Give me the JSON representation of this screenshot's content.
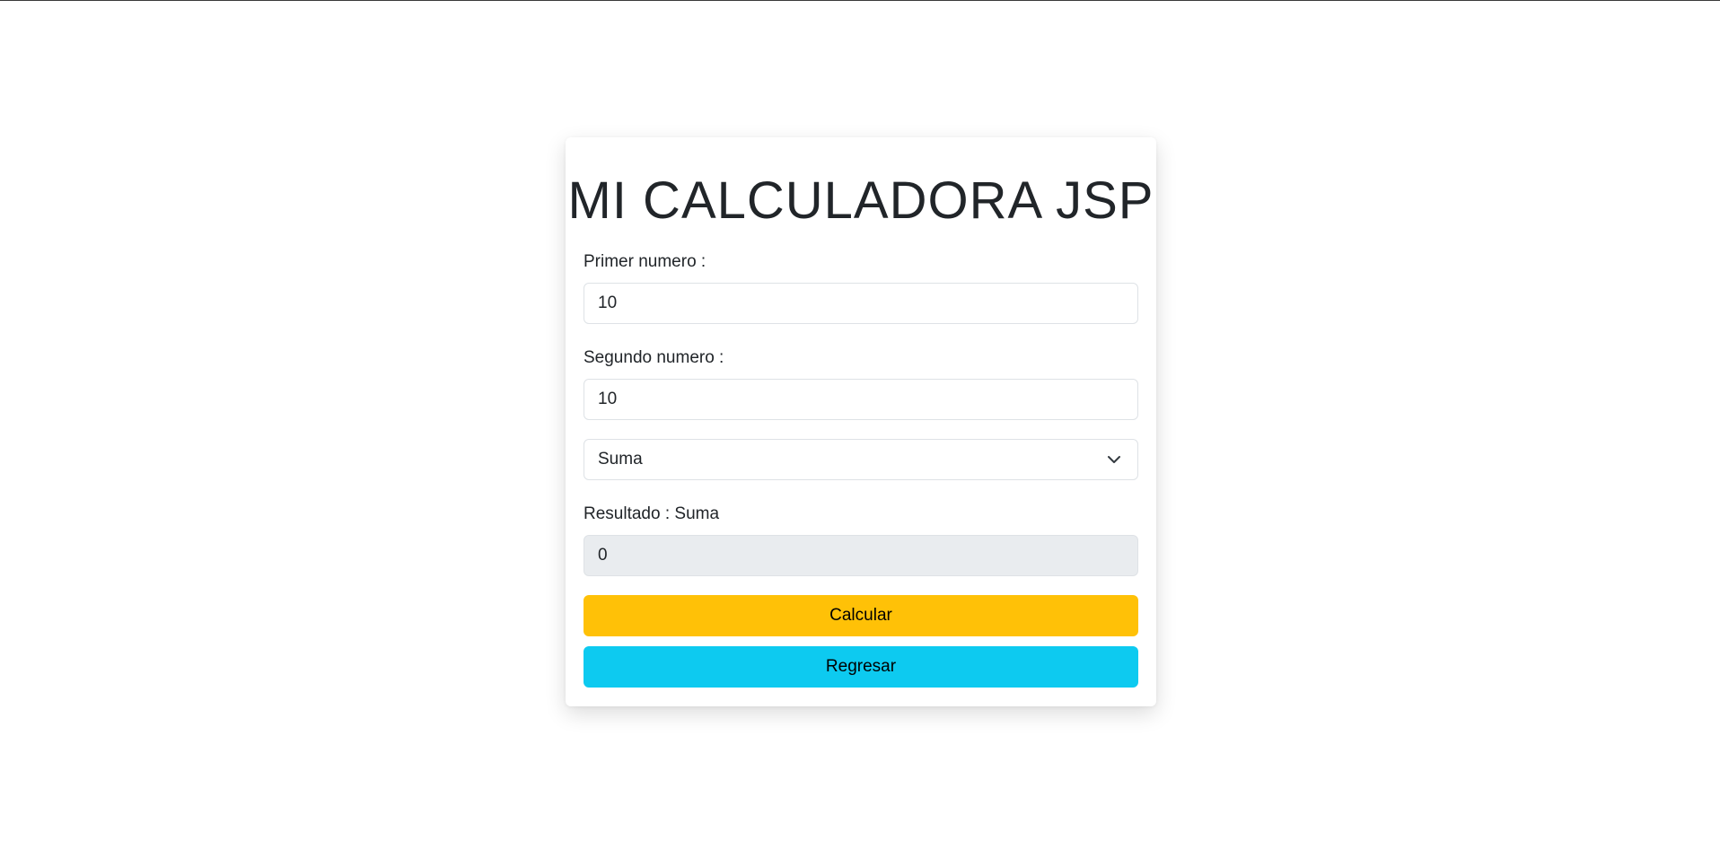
{
  "calculator": {
    "title": "MI CALCULADORA JSP",
    "first": {
      "label": "Primer numero :",
      "value": "10"
    },
    "second": {
      "label": "Segundo numero :",
      "value": "10"
    },
    "operation": {
      "selected": "Suma"
    },
    "result": {
      "label": "Resultado : Suma",
      "value": "0"
    },
    "buttons": {
      "calculate_label": "Calcular",
      "back_label": "Regresar"
    }
  },
  "colors": {
    "calculate_button": "#ffc107",
    "back_button": "#0dcaf0",
    "readonly_field": "#e9ecef",
    "field_border": "#dee2e6",
    "text": "#212529"
  },
  "icons": {
    "select_arrow": "chevron-down-icon"
  }
}
